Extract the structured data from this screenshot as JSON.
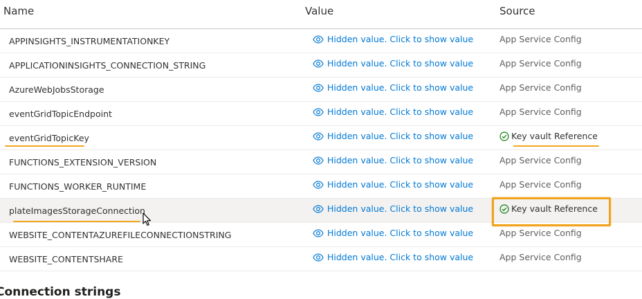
{
  "table": {
    "headers": {
      "name": "Name",
      "value": "Value",
      "source": "Source"
    },
    "rows": [
      {
        "name": "APPINSIGHTS_INSTRUMENTATIONKEY",
        "value": "Hidden value. Click to show value",
        "source": "App Service Config"
      },
      {
        "name": "APPLICATIONINSIGHTS_CONNECTION_STRING",
        "value": "Hidden value. Click to show value",
        "source": "App Service Config"
      },
      {
        "name": "AzureWebJobsStorage",
        "value": "Hidden value. Click to show value",
        "source": "App Service Config"
      },
      {
        "name": "eventGridTopicEndpoint",
        "value": "Hidden value. Click to show value",
        "source": "App Service Config"
      },
      {
        "name": "eventGridTopicKey",
        "value": "Hidden value. Click to show value",
        "source": "Key vault Reference"
      },
      {
        "name": "FUNCTIONS_EXTENSION_VERSION",
        "value": "Hidden value. Click to show value",
        "source": "App Service Config"
      },
      {
        "name": "FUNCTIONS_WORKER_RUNTIME",
        "value": "Hidden value. Click to show value",
        "source": "App Service Config"
      },
      {
        "name": "plateImagesStorageConnection",
        "value": "Hidden value. Click to show value",
        "source": "Key vault Reference"
      },
      {
        "name": "WEBSITE_CONTENTAZUREFILECONNECTIONSTRING",
        "value": "Hidden value. Click to show value",
        "source": "App Service Config"
      },
      {
        "name": "WEBSITE_CONTENTSHARE",
        "value": "Hidden value. Click to show value",
        "source": "App Service Config"
      }
    ]
  },
  "next_section_title": "Connection strings",
  "icons": {
    "value_icon": "eye-icon",
    "keyvault_icon": "check-circle-icon"
  },
  "colors": {
    "link": "#0078d4",
    "success": "#107c10",
    "annotation": "#f2a81f",
    "selected_row": "#f3f2f1"
  }
}
